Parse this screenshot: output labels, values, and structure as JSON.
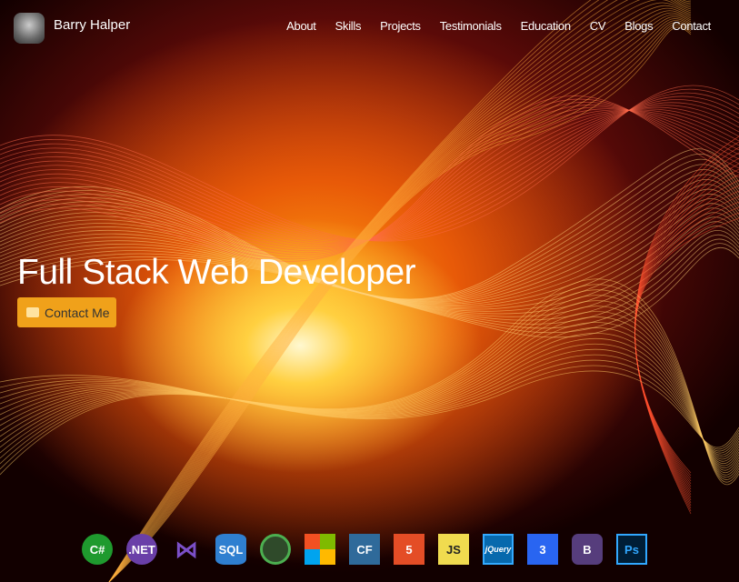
{
  "header": {
    "name": "Barry Halper",
    "nav": [
      "About",
      "Skills",
      "Projects",
      "Testimonials",
      "Education",
      "CV",
      "Blogs",
      "Contact"
    ]
  },
  "hero": {
    "title": "Full Stack Web Developer",
    "cta_label": "Contact Me"
  },
  "skills": [
    {
      "icon": "csharp-icon",
      "label": "C#",
      "color": "#1f9a2e"
    },
    {
      "icon": "dotnet-icon",
      "label": ".NET",
      "color": "#6a3fa8"
    },
    {
      "icon": "visual-studio-icon",
      "label": "",
      "color": "#7b4fc8"
    },
    {
      "icon": "sql-icon",
      "label": "SQL",
      "color": "#2f7fd0"
    },
    {
      "icon": "mongodb-icon",
      "label": "",
      "color": "#2f4a2a"
    },
    {
      "icon": "microsoft-icon",
      "label": "",
      "color": "#f25022"
    },
    {
      "icon": "coldfusion-icon",
      "label": "CF",
      "color": "#2f6a9a"
    },
    {
      "icon": "html5-icon",
      "label": "5",
      "color": "#e44d26"
    },
    {
      "icon": "javascript-icon",
      "label": "JS",
      "color": "#f0db4f"
    },
    {
      "icon": "jquery-icon",
      "label": "jQuery",
      "color": "#0769ad"
    },
    {
      "icon": "css3-icon",
      "label": "3",
      "color": "#2965f1"
    },
    {
      "icon": "bootstrap-icon",
      "label": "B",
      "color": "#563d7c"
    },
    {
      "icon": "photoshop-icon",
      "label": "Ps",
      "color": "#001e36"
    }
  ]
}
